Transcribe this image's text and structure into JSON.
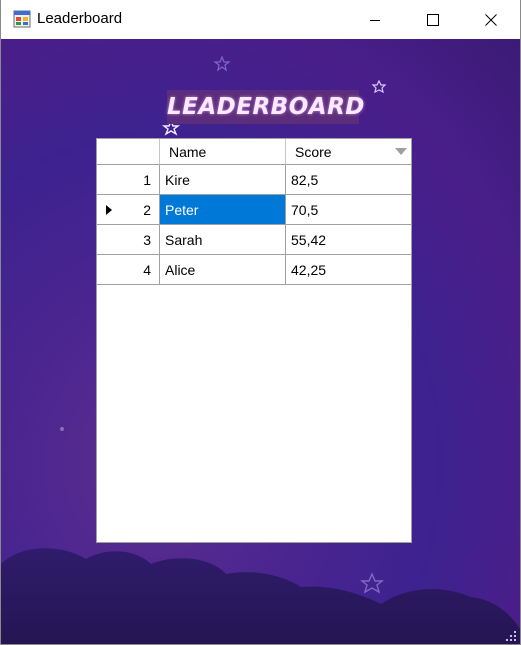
{
  "window": {
    "title": "Leaderboard",
    "icon": "winforms-app-icon",
    "controls": [
      "minimize-icon",
      "maximize-icon",
      "close-icon"
    ]
  },
  "heading": "LEADERBOARD",
  "grid": {
    "columns": [
      "Name",
      "Score"
    ],
    "rows": [
      {
        "index": "1",
        "name": "Kire",
        "score": "82,5"
      },
      {
        "index": "2",
        "name": "Peter",
        "score": "70,5"
      },
      {
        "index": "3",
        "name": "Sarah",
        "score": "55,42"
      },
      {
        "index": "4",
        "name": "Alice",
        "score": "42,25"
      }
    ],
    "current_row": "2",
    "selected_cell": "Peter"
  },
  "colors": {
    "selection": "#0078d7",
    "background": "#3d228f",
    "heading_text": "#fbe9ff"
  }
}
